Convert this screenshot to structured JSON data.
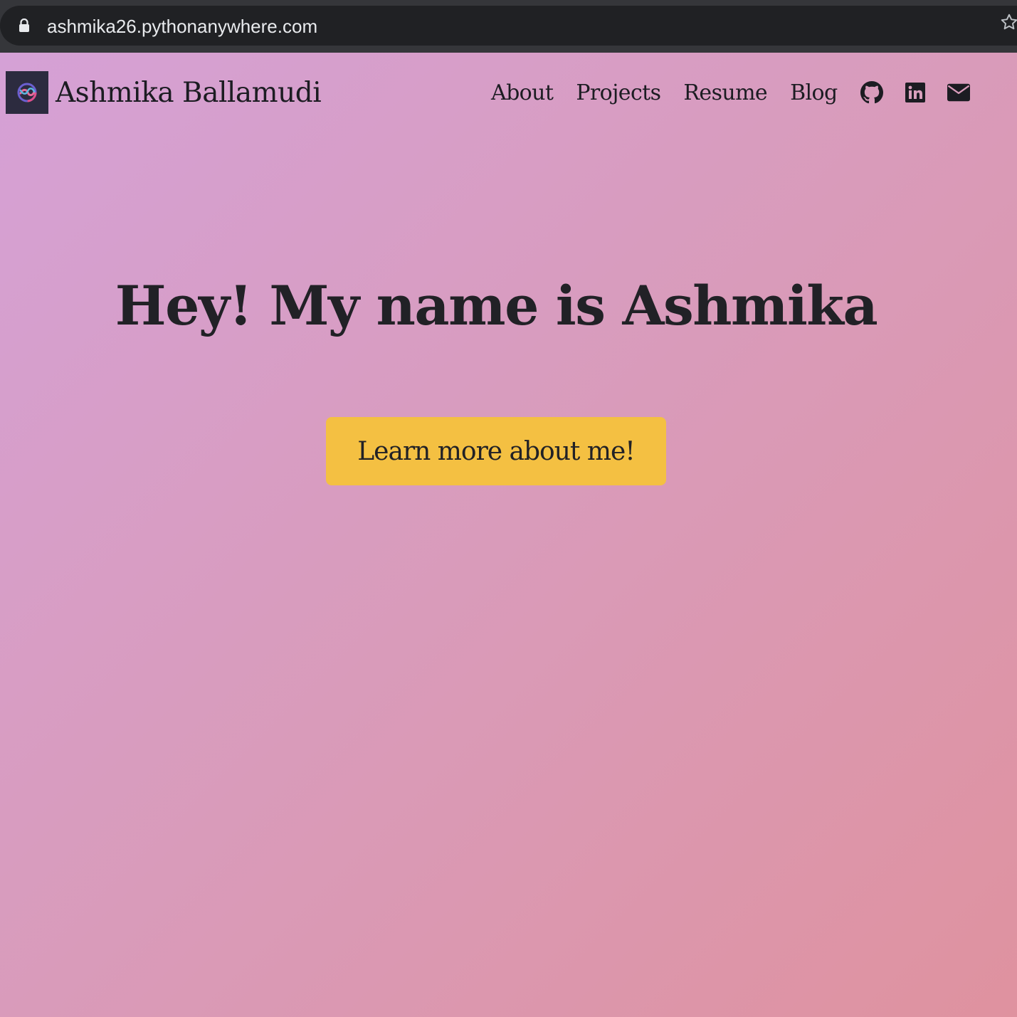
{
  "browser": {
    "url": "ashmika26.pythonanywhere.com",
    "lock_icon": "lock-icon",
    "bookmark_icon": "star-icon"
  },
  "navbar": {
    "brand_name": "Ashmika Ballamudi",
    "brand_logo_icon": "swirl-logo-icon",
    "links": [
      {
        "label": "About"
      },
      {
        "label": "Projects"
      },
      {
        "label": "Resume"
      },
      {
        "label": "Blog"
      }
    ],
    "icons": [
      "github-icon",
      "linkedin-icon",
      "envelope-icon"
    ]
  },
  "hero": {
    "title": "Hey! My name is Ashmika",
    "button_label": "Learn more about me!"
  },
  "colors": {
    "gradient_start": "#d5a1d6",
    "gradient_mid": "#d99bba",
    "gradient_end": "#df929f",
    "button": "#f4c042",
    "text": "#212126"
  }
}
